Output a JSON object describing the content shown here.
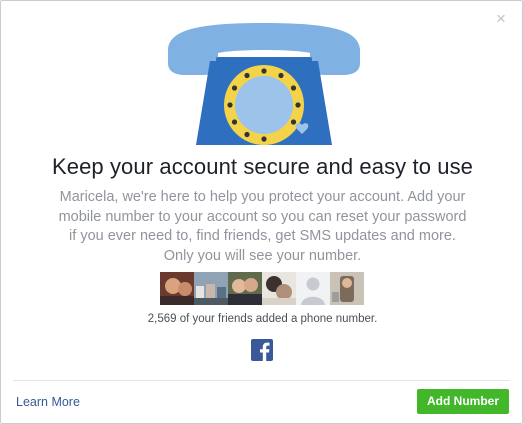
{
  "dialog": {
    "close_symbol": "×",
    "headline": "Keep your account secure and easy to use",
    "message_lines": [
      "Maricela, we're here to help you protect your account. Add your",
      "mobile number to your account so you can reset your password",
      "if you ever need to, find friends, get SMS updates and more.",
      "Only you will see your number."
    ],
    "friends_count_text": "2,569 of your friends added a phone number.",
    "friends_photo_count": 6,
    "learn_more_label": "Learn More",
    "add_number_label": "Add Number"
  },
  "icons": {
    "close": "close-icon",
    "illustration": "telephone-illustration",
    "facebook": "facebook-logo-icon"
  },
  "colors": {
    "brand_blue": "#3b5998",
    "link_blue": "#365899",
    "button_green": "#42b72a",
    "phone_light_blue": "#7fb2e3",
    "phone_dark_blue": "#2f6fbf",
    "dial_yellow": "#f2d34a"
  }
}
